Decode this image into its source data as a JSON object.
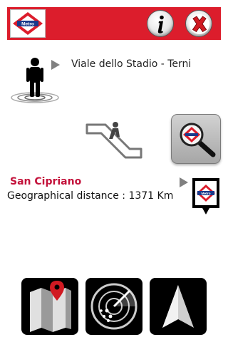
{
  "header": {
    "logo_text": "Metro",
    "info_icon": "info-icon",
    "close_icon": "close-icon",
    "accent_color": "#dc1d2c"
  },
  "location": {
    "address": "Viale dello Stadio - Terni",
    "icon": "person-standing-icon"
  },
  "escalator_icon": "escalator-icon",
  "search_button_icon": "metro-search-icon",
  "station": {
    "name": "San Cipriano",
    "distance_text": "Geographical distance : 1371 Km",
    "name_color": "#c3123b",
    "marker_logo_text": "Metro"
  },
  "bottom_buttons": [
    {
      "icon": "map-pin-icon"
    },
    {
      "icon": "radar-icon"
    },
    {
      "icon": "navigation-arrow-icon"
    }
  ]
}
